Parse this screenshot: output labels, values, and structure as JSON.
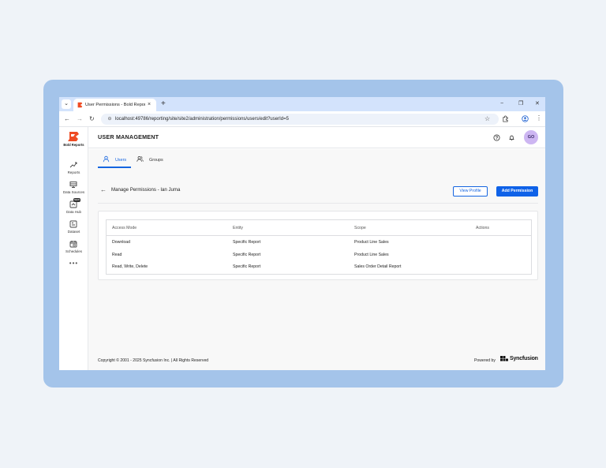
{
  "browser": {
    "tab_title": "User Permissions - Bold Reports",
    "tab_close": "×",
    "new_tab": "+",
    "minimize": "−",
    "restore": "❐",
    "close": "✕",
    "url": "localhost:49786/reporting/site/site2/administration/permissions/users/edit?userId=5",
    "colors": {
      "tabstrip": "#d3e3fc",
      "omnibox": "#edf2fa"
    }
  },
  "sidebar": {
    "brand": "Bold Reports",
    "items": [
      {
        "label": "Reports",
        "icon": "trend-icon"
      },
      {
        "label": "Data Sources",
        "icon": "database-icon"
      },
      {
        "label": "Data Hub",
        "icon": "data-hub-icon",
        "badge": "NEW"
      },
      {
        "label": "Dataset",
        "icon": "dataset-icon"
      },
      {
        "label": "Schedules",
        "icon": "calendar-icon"
      }
    ],
    "more": "•••"
  },
  "header": {
    "title": "USER MANAGEMENT",
    "avatar_initials": "GO",
    "avatar_color": "#cdb6f2"
  },
  "tabs": [
    {
      "label": "Users",
      "icon": "user-icon",
      "active": true
    },
    {
      "label": "Groups",
      "icon": "group-icon",
      "active": false
    }
  ],
  "subheader": {
    "back": "←",
    "title": "Manage Permissions - Ian Juma",
    "view_profile": "View Profile",
    "add_permission": "Add Permission"
  },
  "table": {
    "columns": [
      "Access Mode",
      "Entity",
      "Scope",
      "Actions"
    ],
    "rows": [
      [
        "Download",
        "Specific Report",
        "Product Line Sales",
        ""
      ],
      [
        "Read",
        "Specific Report",
        "Product Line Sales",
        ""
      ],
      [
        "Read, Write, Delete",
        "Specific Report",
        "Sales Order Detail Report",
        ""
      ]
    ]
  },
  "footer": {
    "copyright": "Copyright © 2001 - 2025 Syncfusion Inc.   |   All Rights Reserved",
    "powered_by": "Powered by",
    "brand": "Syncfusion"
  },
  "accent": "#1565e0"
}
